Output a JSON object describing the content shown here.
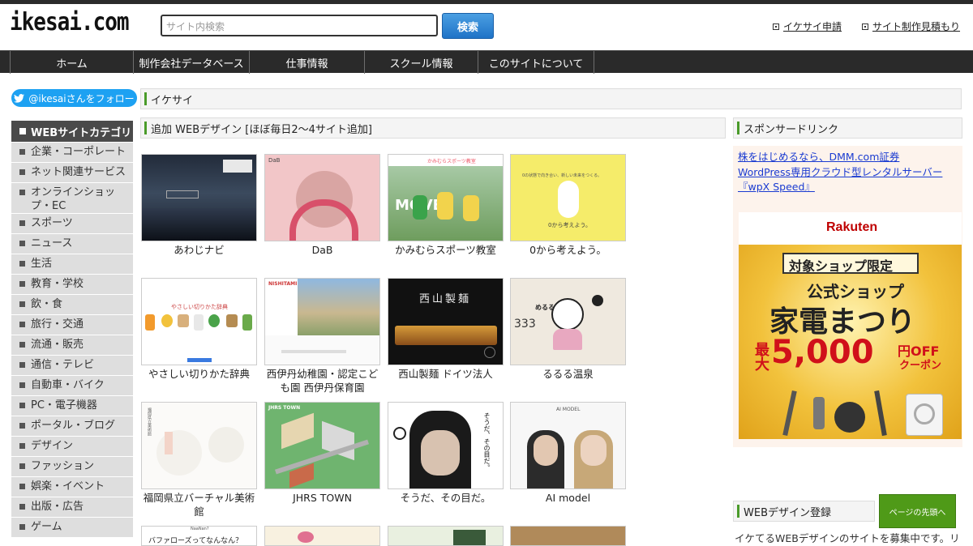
{
  "logo": "ikesai.com",
  "search": {
    "placeholder": "サイト内検索",
    "button": "検索"
  },
  "header_links": [
    "イケサイ申請",
    "サイト制作見積もり"
  ],
  "nav": [
    "ホーム",
    "制作会社データベース",
    "仕事情報",
    "スクール情報",
    "このサイトについて"
  ],
  "twitter_follow": "@ikesaiさんをフォロー",
  "breadcrumb": "イケサイ",
  "sidebar": {
    "heading": "WEBサイトカテゴリ",
    "items": [
      "企業・コーポレート",
      "ネット関連サービス",
      "オンラインショップ・EC",
      "スポーツ",
      "ニュース",
      "生活",
      "教育・学校",
      "飲・食",
      "旅行・交通",
      "流通・販売",
      "通信・テレビ",
      "自動車・バイク",
      "PC・電子機器",
      "ポータル・ブログ",
      "デザイン",
      "ファッション",
      "娯楽・イベント",
      "出版・広告",
      "ゲーム"
    ]
  },
  "main": {
    "section_title": "追加 WEBデザイン [ほぼ毎日2～4サイト追加]",
    "sites": [
      {
        "name": "あわじナビ"
      },
      {
        "name": "DaB"
      },
      {
        "name": "かみむらスポーツ教室"
      },
      {
        "name": "0から考えよう。"
      },
      {
        "name": "やさしい切りかた辞典"
      },
      {
        "name": "西伊丹幼稚園・認定こども園 西伊丹保育園"
      },
      {
        "name": "西山製麺 ドイツ法人"
      },
      {
        "name": "るるる温泉"
      },
      {
        "name": "福岡県立バーチャル美術館"
      },
      {
        "name": "JHRS TOWN"
      },
      {
        "name": "そうだ、その目だ。"
      },
      {
        "name": "AI model"
      }
    ],
    "thumb_texts": {
      "dab": "DaB",
      "kamimura_header": "かみむらスポーツ教室",
      "kamimura_big": "MOVE",
      "zero_top": "0の状態で向き合い、新しい未来をつくる。",
      "zero_bottom": "0から考えよう。",
      "yasashii": "やさしい切りかた辞典",
      "nishiitami": "NISHITAMI",
      "nishiyama": "西山製麺",
      "rururu": "めるる",
      "rururu_nums": "333",
      "fukuoka": "福岡県立美術館",
      "jhrs": "JHRS TOWN",
      "souda": "そうだ、その目だ。",
      "aimodel": "AI MODEL",
      "row4_1": "バファローズってなんなん？",
      "row4_2": "NaaNan?"
    }
  },
  "sponsor": {
    "title": "スポンサードリンク",
    "links": [
      "株をはじめるなら、DMM.com証券",
      "WordPress専用クラウド型レンタルサーバー",
      "『wpX Speed』"
    ],
    "ad": {
      "brand": "Rakuten",
      "line1": "対象ショップ限定",
      "line2": "公式ショップ",
      "line3": "家電まつり",
      "line4a": "最大",
      "line4b": "5,000",
      "line4c": "円OFF",
      "line4d": "クーポン"
    }
  },
  "register": {
    "title": "WEBデザイン登録",
    "text": "イケてるWEBデザインのサイトを募集中です。リ"
  },
  "page_top": "ページの先頭へ",
  "colors": {
    "accent_green": "#4a9b2a",
    "nav_bg": "#2a2a2a",
    "search_btn": "#1f73c7",
    "twitter": "#1da1f2"
  }
}
